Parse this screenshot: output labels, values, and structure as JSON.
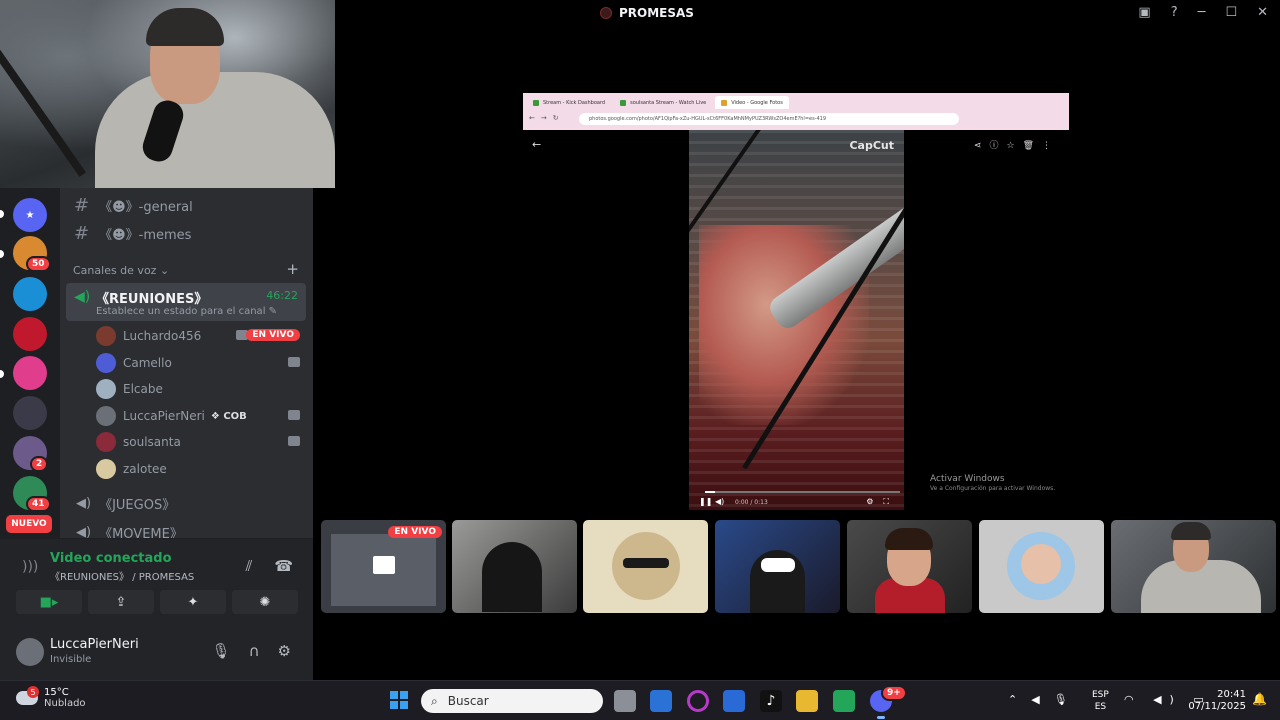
{
  "window": {
    "title": "PROMESAS"
  },
  "channels": {
    "text": [
      {
        "name": "《☻》-general"
      },
      {
        "name": "《☻》-memes"
      }
    ],
    "voice_category": "Canales de voz",
    "active_voice": {
      "name": "《REUNIONES》",
      "timer": "46:22",
      "status_hint": "Establece un estado para el canal"
    },
    "members": [
      {
        "name": "Luchardo456",
        "live": "EN VIVO"
      },
      {
        "name": "Camello"
      },
      {
        "name": "Elcabe"
      },
      {
        "name": "LuccaPierNeri",
        "tag": "COB"
      },
      {
        "name": "soulsanta"
      },
      {
        "name": "zalotee"
      }
    ],
    "other_voice": [
      {
        "name": "《JUEGOS》"
      },
      {
        "name": "《MOVEME》"
      }
    ]
  },
  "servers": {
    "badges": [
      "50",
      "2",
      "41"
    ],
    "new_label": "NUEVO"
  },
  "voice_panel": {
    "title": "Video conectado",
    "subtitle": "《REUNIONES》 / PROMESAS"
  },
  "user_panel": {
    "name": "LuccaPierNeri",
    "status": "Invisible"
  },
  "shared_screen": {
    "tabs": [
      "Stream - Kick Dashboard",
      "soulsanta Stream - Watch Live",
      "Video - Google Fotos"
    ],
    "url": "photos.google.com/photo/AF1QipFa-xZu-HGUL-sCt6FF0KaMhNMyPUZ3RWsZO4emE?hl=es-419",
    "watermark": "CapCut",
    "video_time": "0:00 / 0:13",
    "progress": 0.05,
    "activate_title": "Activar Windows",
    "activate_sub": "Ve a Configuración para activar Windows."
  },
  "tiles": {
    "live_label": "EN VIVO"
  },
  "taskbar": {
    "temp": "15°C",
    "condition": "Nublado",
    "weather_badge": "5",
    "search_placeholder": "Buscar",
    "lang_top": "ESP",
    "lang_bottom": "ES",
    "time": "20:41",
    "date": "07/11/2025",
    "discord_badge": "9+"
  }
}
